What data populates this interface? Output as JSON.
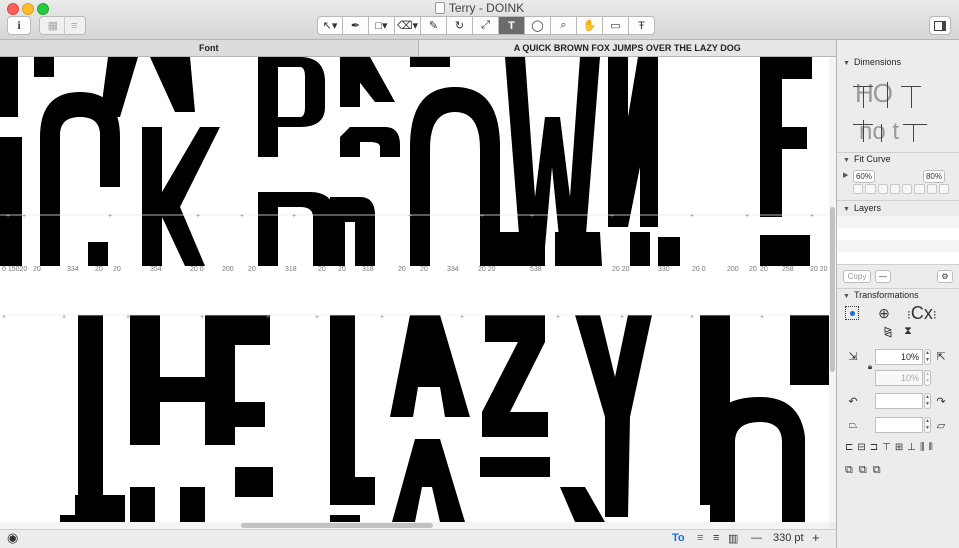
{
  "window": {
    "title": "Terry - DOINK"
  },
  "toolbar": {
    "info_label": "i",
    "tools": [
      {
        "name": "select-tool",
        "glyph": "↖▾"
      },
      {
        "name": "pen-tool",
        "glyph": "✒"
      },
      {
        "name": "shape-tool",
        "glyph": "□▾"
      },
      {
        "name": "eraser-tool",
        "glyph": "⌫▾"
      },
      {
        "name": "pencil-tool",
        "glyph": "✎"
      },
      {
        "name": "rotate-tool",
        "glyph": "↻"
      },
      {
        "name": "resize-tool",
        "glyph": "⤢"
      },
      {
        "name": "text-tool",
        "glyph": "T"
      },
      {
        "name": "comment-tool",
        "glyph": "◯"
      },
      {
        "name": "zoom-tool",
        "glyph": "⌕"
      },
      {
        "name": "hand-tool",
        "glyph": "✋"
      },
      {
        "name": "ruler-tool",
        "glyph": "▭"
      },
      {
        "name": "type-tool",
        "glyph": "Ŧ"
      }
    ],
    "active_tool": "text-tool"
  },
  "tabs": [
    {
      "label": "Font"
    },
    {
      "label": "A QUICK BROWN FOX JUMPS OVER THE LAZY DOG"
    }
  ],
  "canvas": {
    "row1_metrics": [
      "0 15020",
      "20",
      "334",
      "20",
      "20",
      "354",
      "20 0",
      "200",
      "20",
      "318",
      "20",
      "20",
      "318",
      "20",
      "20",
      "334",
      "20 20",
      "538",
      "20 20",
      "330",
      "20 0",
      "200",
      "20",
      "20",
      "258",
      "20 20"
    ]
  },
  "inspector": {
    "dimensions_title": "Dimensions",
    "dim_sample_1": "HO",
    "dim_sample_2": "no t",
    "fit_curve_title": "Fit Curve",
    "fit_curve_min": "60%",
    "fit_curve_max": "80%",
    "layers_title": "Layers",
    "copy_label": "Copy",
    "minus_label": "—",
    "transformations_title": "Transformations",
    "transform_cx_label": "Cx",
    "scale_value": "10%",
    "scale_value_2": "10%",
    "rotate_value": "",
    "skew_value": ""
  },
  "statusbar": {
    "zoom_label": "330 pt",
    "minus": "—",
    "plus": "+",
    "text_style": "To"
  }
}
